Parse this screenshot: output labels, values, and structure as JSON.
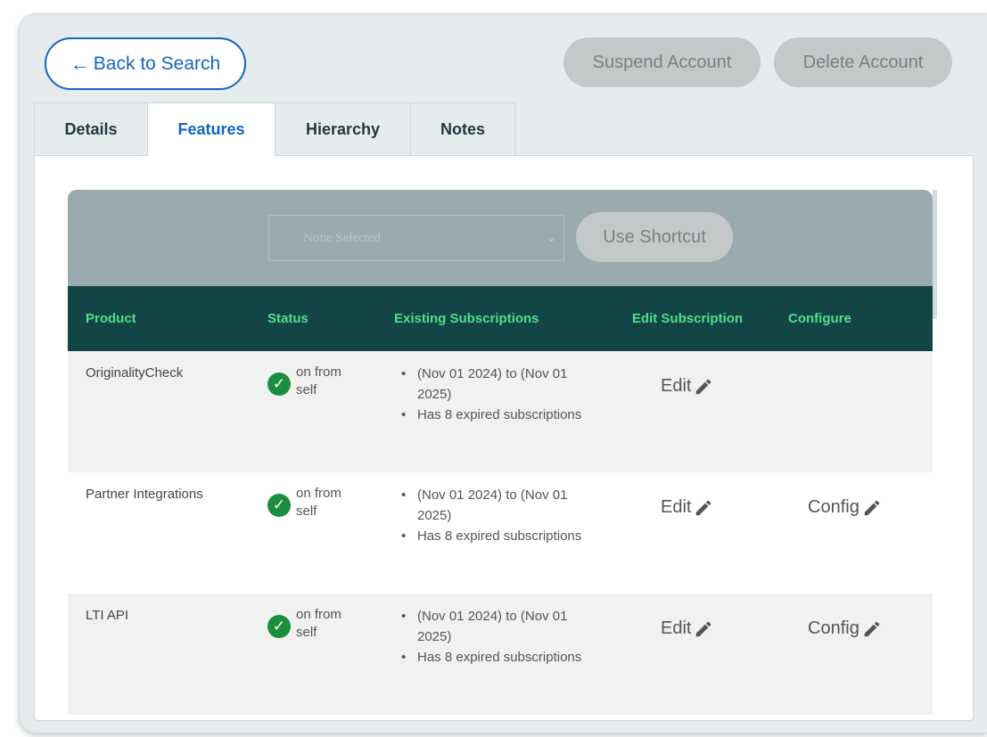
{
  "header": {
    "back_label": "Back to Search",
    "suspend_label": "Suspend Account",
    "delete_label": "Delete Account"
  },
  "tabs": [
    {
      "label": "Details",
      "active": false
    },
    {
      "label": "Features",
      "active": true
    },
    {
      "label": "Hierarchy",
      "active": false
    },
    {
      "label": "Notes",
      "active": false
    }
  ],
  "shortcut": {
    "select_value": "None Selected",
    "button_label": "Use Shortcut"
  },
  "table": {
    "columns": [
      "Product",
      "Status",
      "Existing Subscriptions",
      "Edit Subscription",
      "Configure"
    ],
    "rows": [
      {
        "product": "OriginalityCheck",
        "status": "on from self",
        "subscriptions": [
          "(Nov 01 2024) to (Nov 01 2025)",
          "Has 8 expired subscriptions"
        ],
        "edit_label": "Edit",
        "config_label": ""
      },
      {
        "product": "Partner Integrations",
        "status": "on from self",
        "subscriptions": [
          "(Nov 01 2024) to (Nov 01 2025)",
          "Has 8 expired subscriptions"
        ],
        "edit_label": "Edit",
        "config_label": "Config"
      },
      {
        "product": "LTI API",
        "status": "on from self",
        "subscriptions": [
          "(Nov 01 2024) to (Nov 01 2025)",
          "Has 8 expired subscriptions"
        ],
        "edit_label": "Edit",
        "config_label": "Config"
      }
    ]
  },
  "colors": {
    "accent_blue": "#1565c0",
    "table_header_bg": "#134446",
    "table_header_text": "#4fe08a",
    "status_ok": "#1b8e3d"
  },
  "icons": {
    "back": "arrow-left-icon",
    "status": "check-circle-icon",
    "edit": "pencil-icon",
    "select": "chevron-down-icon"
  }
}
